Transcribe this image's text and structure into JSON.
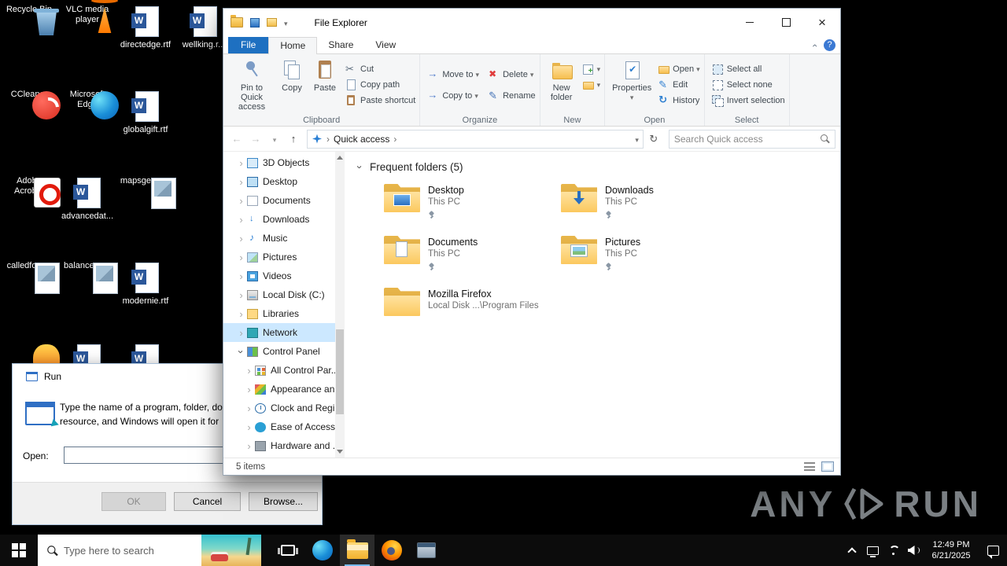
{
  "colors": {
    "accent_blue": "#1e70c1",
    "selection_blue": "#cce8ff",
    "folder_yellow": "#fbc85e",
    "taskbar_black": "#0c0c0c"
  },
  "desktop": {
    "icons": [
      {
        "label": "Recycle Bin",
        "type": "recycle-bin"
      },
      {
        "label": "VLC media player",
        "type": "vlc"
      },
      {
        "label": "directedge.rtf",
        "type": "word-doc"
      },
      {
        "label": "wellking.r...",
        "type": "word-doc"
      },
      {
        "label": "CCleaner",
        "type": "ccleaner"
      },
      {
        "label": "Microsoft Edge",
        "type": "edge"
      },
      {
        "label": "globalgift.rtf",
        "type": "word-doc"
      },
      {
        "label": "Adobe Acrobat",
        "type": "acrobat"
      },
      {
        "label": "advancedat...",
        "type": "word-doc"
      },
      {
        "label": "mapsgeorg...",
        "type": "image-doc"
      },
      {
        "label": "calledforu...",
        "type": "image-doc"
      },
      {
        "label": "balanceun...",
        "type": "image-doc"
      },
      {
        "label": "modernie.rtf",
        "type": "word-doc"
      },
      {
        "label": "",
        "type": "flame"
      },
      {
        "label": "",
        "type": "word-doc"
      },
      {
        "label": "",
        "type": "word-doc"
      }
    ]
  },
  "explorer": {
    "window_title": "File Explorer",
    "tabs": {
      "file": "File",
      "home": "Home",
      "share": "Share",
      "view": "View"
    },
    "ribbon": {
      "pin_label": "Pin to Quick access",
      "copy": "Copy",
      "paste": "Paste",
      "cut": "Cut",
      "copy_path": "Copy path",
      "paste_shortcut": "Paste shortcut",
      "clipboard_group": "Clipboard",
      "move_to": "Move to",
      "copy_to": "Copy to",
      "delete": "Delete",
      "rename": "Rename",
      "organize_group": "Organize",
      "new_folder": "New folder",
      "new_group": "New",
      "properties": "Properties",
      "open": "Open",
      "edit": "Edit",
      "history": "History",
      "open_group": "Open",
      "select_all": "Select all",
      "select_none": "Select none",
      "invert_selection": "Invert selection",
      "select_group": "Select"
    },
    "address": {
      "location": "Quick access",
      "search_placeholder": "Search Quick access"
    },
    "nav_items": [
      {
        "label": "3D Objects"
      },
      {
        "label": "Desktop"
      },
      {
        "label": "Documents"
      },
      {
        "label": "Downloads"
      },
      {
        "label": "Music"
      },
      {
        "label": "Pictures"
      },
      {
        "label": "Videos"
      },
      {
        "label": "Local Disk (C:)"
      },
      {
        "label": "Libraries"
      },
      {
        "label": "Network"
      },
      {
        "label": "Control Panel"
      },
      {
        "label": "All Control Par..."
      },
      {
        "label": "Appearance an..."
      },
      {
        "label": "Clock and Regi..."
      },
      {
        "label": "Ease of Access"
      },
      {
        "label": "Hardware and ..."
      }
    ],
    "content": {
      "section_title": "Frequent folders (5)",
      "tiles": [
        {
          "name": "Desktop",
          "location": "This PC"
        },
        {
          "name": "Downloads",
          "location": "This PC"
        },
        {
          "name": "Documents",
          "location": "This PC"
        },
        {
          "name": "Pictures",
          "location": "This PC"
        },
        {
          "name": "Mozilla Firefox",
          "location": "Local Disk ...\\Program Files"
        }
      ]
    },
    "status_bar": {
      "items_count": "5 items"
    }
  },
  "run_dialog": {
    "title": "Run",
    "message_line1": "Type the name of a program, folder, do",
    "message_line2": "resource, and Windows will open it for",
    "open_label": "Open:",
    "input_value": "",
    "ok": "OK",
    "cancel": "Cancel",
    "browse": "Browse..."
  },
  "taskbar": {
    "search_placeholder": "Type here to search",
    "time": "12:49 PM",
    "date": "6/21/2025"
  },
  "watermark": {
    "left": "ANY",
    "right": "RUN"
  }
}
